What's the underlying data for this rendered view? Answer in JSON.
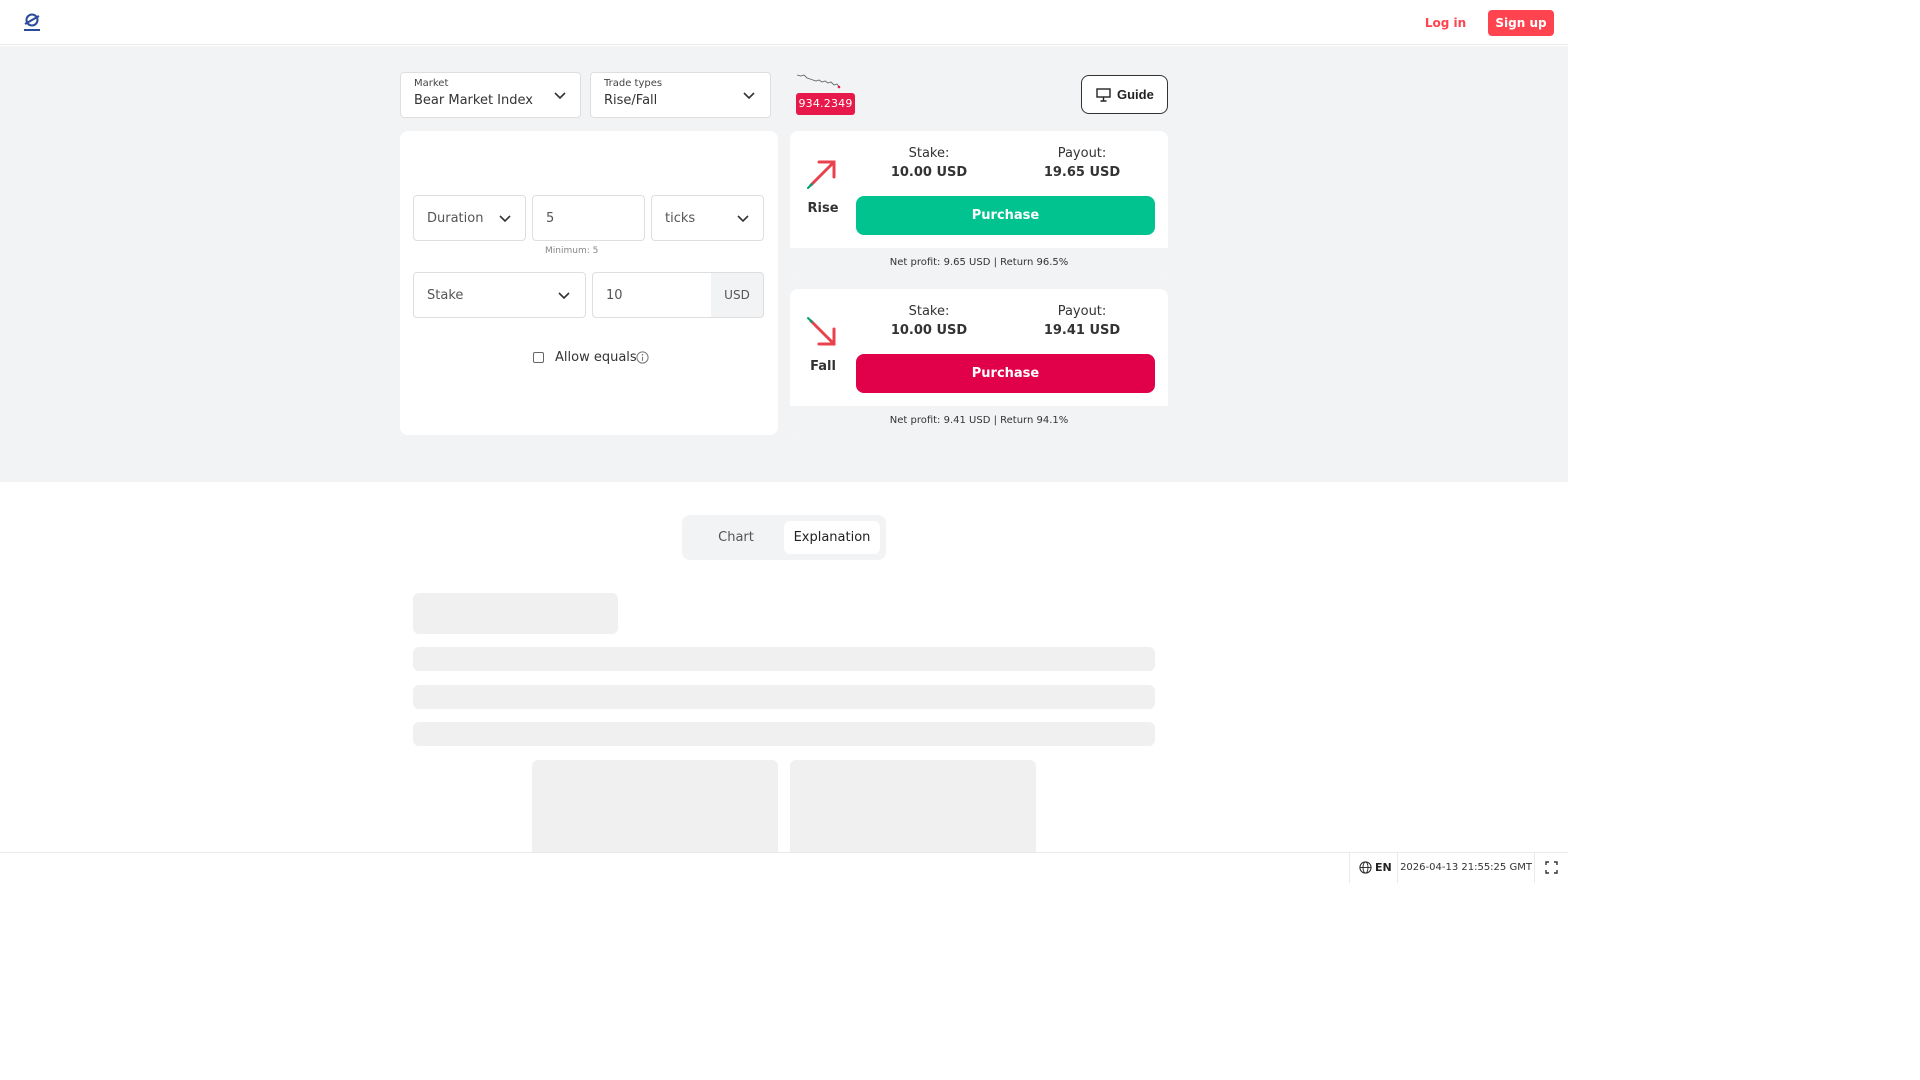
{
  "header": {
    "login_label": "Log in",
    "signup_label": "Sign up"
  },
  "market": {
    "caption": "Market",
    "value": "Bear Market Index"
  },
  "trade_type": {
    "caption": "Trade types",
    "value": "Rise/Fall"
  },
  "current_price": "934.2349",
  "guide_label": "Guide",
  "params": {
    "duration_type": "Duration",
    "duration_value": "5",
    "duration_unit": "ticks",
    "duration_min_note": "Minimum: 5",
    "stake_type": "Stake",
    "stake_value": "10",
    "currency": "USD",
    "allow_equals_label": "Allow equals",
    "allow_equals_checked": false
  },
  "contracts": [
    {
      "type": "Rise",
      "stake_label": "Stake:",
      "stake": "10.00 USD",
      "payout_label": "Payout:",
      "payout": "19.65 USD",
      "button": "Purchase",
      "footer": "Net profit: 9.65 USD | Return 96.5%",
      "color": "#00c390"
    },
    {
      "type": "Fall",
      "stake_label": "Stake:",
      "stake": "10.00 USD",
      "payout_label": "Payout:",
      "payout": "19.41 USD",
      "button": "Purchase",
      "footer": "Net profit: 9.41 USD | Return 94.1%",
      "color": "#e1004a"
    }
  ],
  "tabs": [
    {
      "label": "Chart",
      "active": false
    },
    {
      "label": "Explanation",
      "active": true
    }
  ],
  "footer": {
    "language": "EN",
    "server_time": "2026-04-13 21:55:25 GMT"
  },
  "colors": {
    "brand": "#ff444f",
    "rise": "#00c390",
    "fall": "#e1004a",
    "price_badge": "#e6194a",
    "panel_bg": "#f2f3f4"
  },
  "icons": [
    "deriv-logo",
    "chevron-down-icon",
    "guide-icon",
    "rise-arrow-icon",
    "fall-arrow-icon",
    "info-icon",
    "globe-icon",
    "fullscreen-icon"
  ]
}
